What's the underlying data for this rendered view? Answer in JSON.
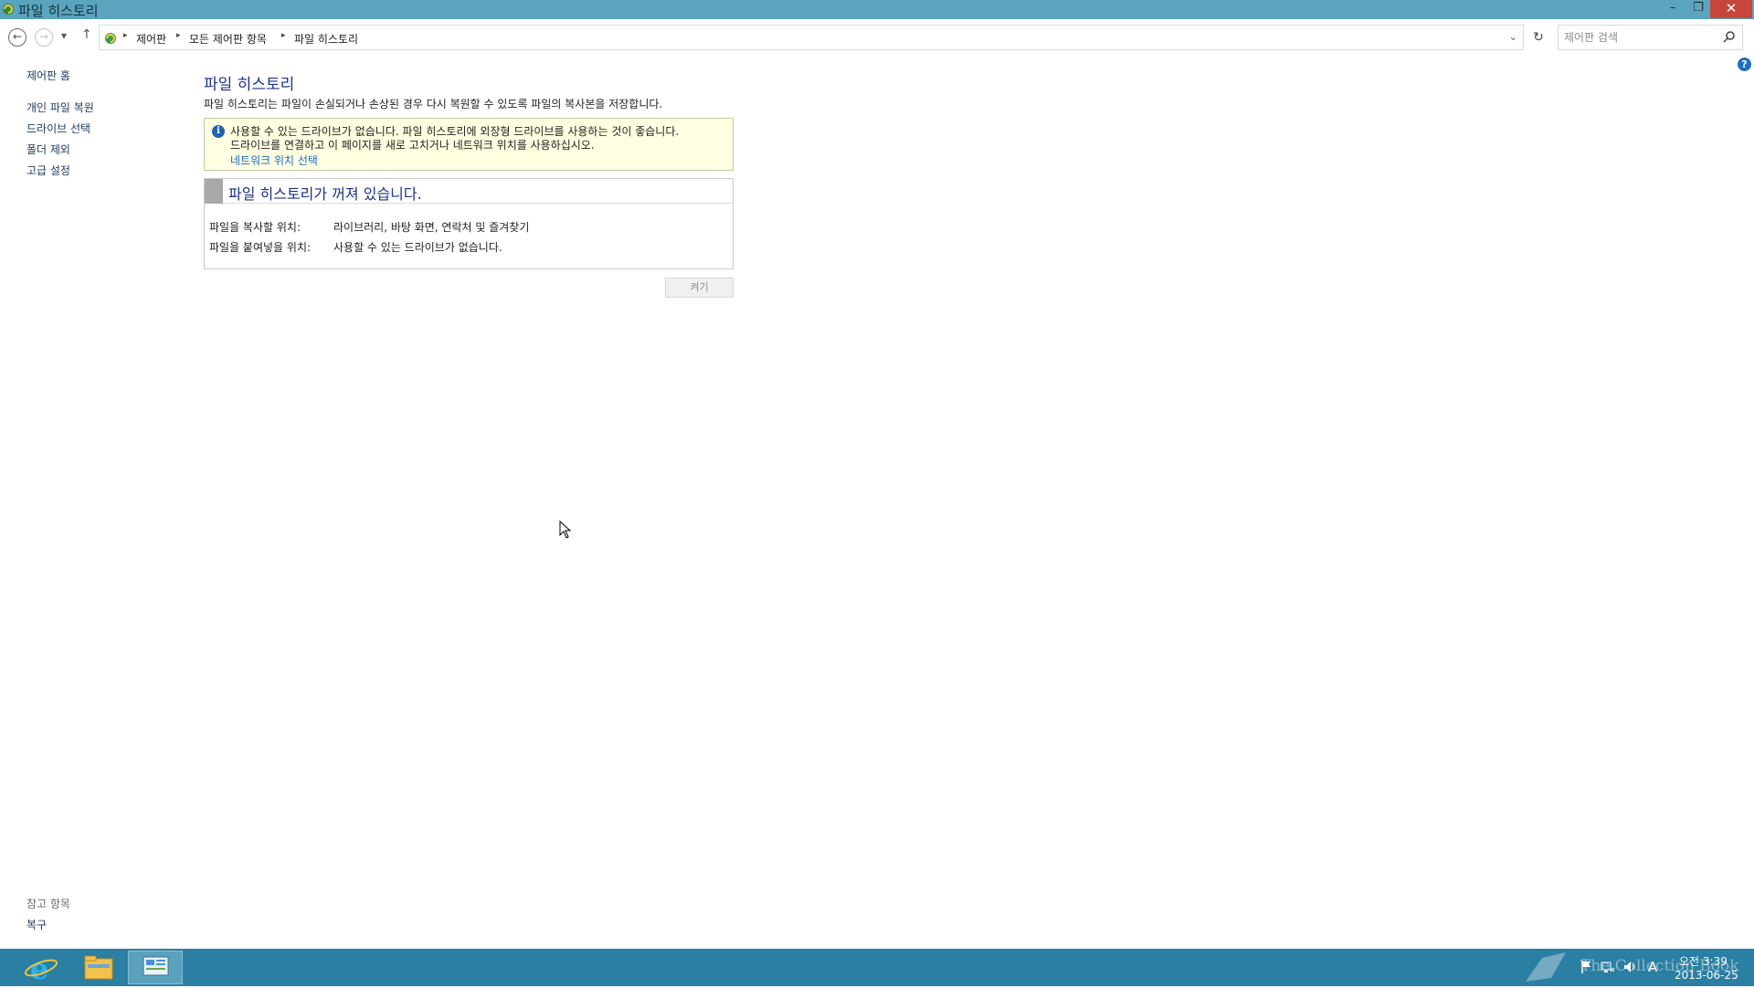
{
  "window": {
    "title": "파일 히스토리",
    "minimize": "–",
    "maximize": "❐",
    "close": "✕"
  },
  "nav": {
    "back": "←",
    "forward": "→",
    "recent": "▾",
    "up": "↑",
    "breadcrumbs": [
      "제어판",
      "모든 제어판 항목",
      "파일 히스토리"
    ],
    "separator": "▸",
    "dropdown": "⌄",
    "refresh": "↻"
  },
  "search": {
    "placeholder": "제어판 검색"
  },
  "sidebar": {
    "home": "제어판 홈",
    "items": [
      {
        "label": "개인 파일 복원"
      },
      {
        "label": "드라이브 선택"
      },
      {
        "label": "폴더 제외"
      },
      {
        "label": "고급 설정"
      }
    ],
    "see_also_header": "참고 항목",
    "see_also_items": [
      {
        "label": "복구"
      }
    ]
  },
  "main": {
    "title": "파일 히스토리",
    "description": "파일 히스토리는 파일이 손실되거나 손상된 경우 다시 복원할 수 있도록 파일의 복사본을 저장합니다.",
    "info": {
      "line1": "사용할 수 있는 드라이브가 없습니다. 파일 히스토리에 외장형 드라이브를 사용하는 것이 좋습니다.",
      "line2": "드라이브를 연결하고 이 페이지를 새로 고치거나 네트워크 위치를 사용하십시오.",
      "link": "네트워크 위치 선택"
    },
    "status": {
      "title": "파일 히스토리가 꺼져 있습니다.",
      "rows": [
        {
          "label": "파일을 복사할 위치:",
          "value": "라이브러리, 바탕 화면, 연락처 및 즐겨찾기"
        },
        {
          "label": "파일을 붙여넣을 위치:",
          "value": "사용할 수 있는 드라이브가 없습니다."
        }
      ]
    },
    "turn_on_button": "켜기"
  },
  "help": "?",
  "taskbar": {
    "items": [
      {
        "name": "internet-explorer-icon"
      },
      {
        "name": "file-explorer-icon"
      },
      {
        "name": "control-panel-icon",
        "active": true
      }
    ],
    "watermark": "The Collection Book",
    "tray": {
      "lang": "A"
    },
    "clock_time": "오전 3:39",
    "clock_date": "2013-06-25"
  }
}
